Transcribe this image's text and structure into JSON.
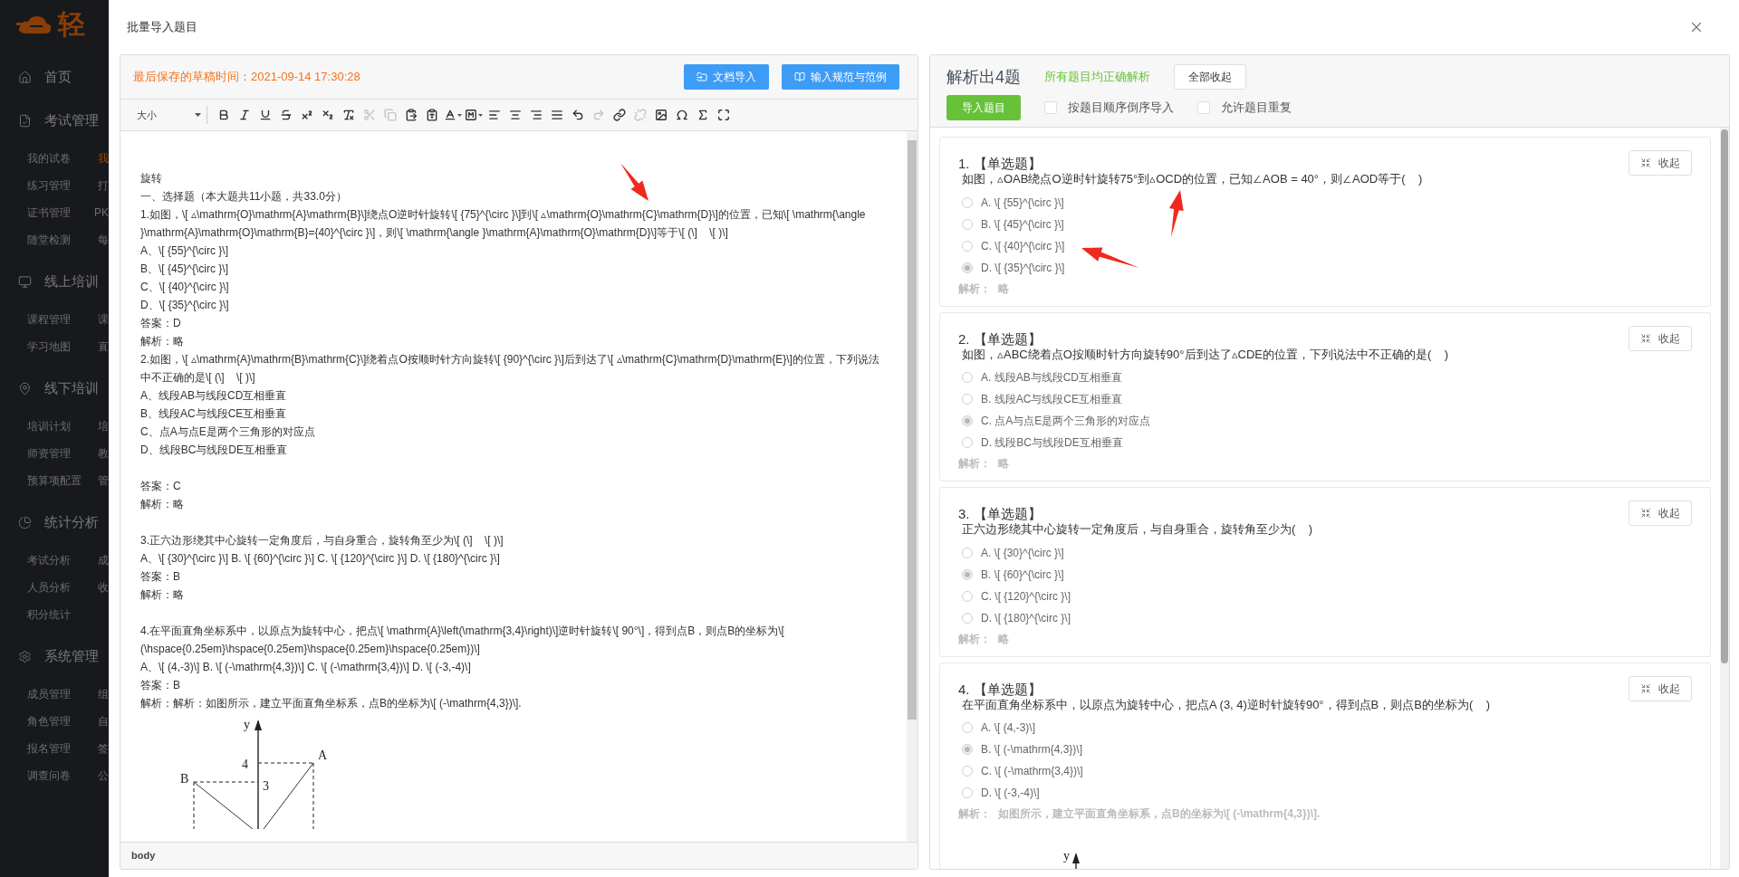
{
  "sidebar": {
    "logo": "轻",
    "sections": [
      {
        "label": "首页"
      },
      {
        "label": "考试管理",
        "rows": [
          [
            {
              "label": "我的试卷",
              "selected": false
            },
            {
              "label": "我",
              "selected": true
            }
          ],
          [
            {
              "label": "练习管理",
              "selected": false
            },
            {
              "label": "打",
              "selected": false
            }
          ],
          [
            {
              "label": "证书管理",
              "selected": false
            },
            {
              "label": "PK",
              "selected": false
            }
          ],
          [
            {
              "label": "随堂检测",
              "selected": false
            },
            {
              "label": "每",
              "selected": false
            }
          ]
        ]
      },
      {
        "label": "线上培训",
        "rows": [
          [
            {
              "label": "课程管理",
              "selected": false
            },
            {
              "label": "课",
              "selected": false
            }
          ],
          [
            {
              "label": "学习地图",
              "selected": false
            },
            {
              "label": "直",
              "selected": false
            }
          ]
        ]
      },
      {
        "label": "线下培训",
        "rows": [
          [
            {
              "label": "培训计划",
              "selected": false
            },
            {
              "label": "培",
              "selected": false
            }
          ],
          [
            {
              "label": "师资管理",
              "selected": false
            },
            {
              "label": "教",
              "selected": false
            }
          ],
          [
            {
              "label": "预算项配置",
              "selected": false
            },
            {
              "label": "管",
              "selected": false
            }
          ]
        ]
      },
      {
        "label": "统计分析",
        "rows": [
          [
            {
              "label": "考试分析",
              "selected": false
            },
            {
              "label": "成",
              "selected": false
            }
          ],
          [
            {
              "label": "人员分析",
              "selected": false
            },
            {
              "label": "收",
              "selected": false
            }
          ],
          [
            {
              "label": "积分统计",
              "selected": false
            }
          ]
        ]
      },
      {
        "label": "系统管理",
        "rows": [
          [
            {
              "label": "成员管理",
              "selected": false
            },
            {
              "label": "组",
              "selected": false
            }
          ],
          [
            {
              "label": "角色管理",
              "selected": false
            },
            {
              "label": "自",
              "selected": false
            }
          ],
          [
            {
              "label": "报名管理",
              "selected": false
            },
            {
              "label": "签",
              "selected": false
            }
          ],
          [
            {
              "label": "调查问卷",
              "selected": false
            },
            {
              "label": "公",
              "selected": false
            }
          ]
        ]
      }
    ]
  },
  "dialog": {
    "title": "批量导入题目"
  },
  "editor": {
    "saved_label": "最后保存的草稿时间：2021-09-14 17:30:28",
    "buttons": [
      "文档导入",
      "输入规范与范例"
    ],
    "toolbar": {
      "size_select": "大小",
      "tools": [
        {
          "disabled": false
        },
        {
          "disabled": false
        },
        {
          "disabled": false
        },
        {
          "disabled": false
        },
        {
          "disabled": false
        },
        {
          "disabled": false
        },
        {
          "disabled": false
        },
        {
          "disabled": true
        },
        {
          "disabled": true
        },
        {
          "disabled": false
        },
        {
          "disabled": false
        },
        {
          "disabled": false
        },
        {
          "disabled": false
        },
        {
          "disabled": false
        },
        {
          "disabled": false
        },
        {
          "disabled": false
        },
        {
          "disabled": false
        },
        {
          "disabled": false
        },
        {
          "disabled": true
        },
        {
          "disabled": false
        },
        {
          "disabled": true
        },
        {
          "disabled": false
        },
        {
          "disabled": false
        },
        {
          "disabled": false
        },
        {
          "disabled": false
        }
      ]
    },
    "groups": [
      [
        "旋转",
        "一、选择题（本大题共11小题，共33.0分）",
        "1.如图，\\[ ▵\\mathrm{O}\\mathrm{A}\\mathrm{B}\\]绕点O逆时针旋转\\[ {75}^{\\circ }\\]到\\[ ▵\\mathrm{O}\\mathrm{C}\\mathrm{D}\\]的位置，已知\\[ \\mathrm{\\angle }\\mathrm{A}\\mathrm{O}\\mathrm{B}={40}^{\\circ }\\]，则\\[ \\mathrm{\\angle }\\mathrm{A}\\mathrm{O}\\mathrm{D}\\]等于\\[ (\\]    \\[ )\\]",
        "A、\\[ {55}^{\\circ }\\]",
        "B、\\[ {45}^{\\circ }\\]",
        "C、\\[ {40}^{\\circ }\\]",
        "D、\\[ {35}^{\\circ }\\]",
        "答案：D",
        "解析：略",
        "2.如图，\\[ ▵\\mathrm{A}\\mathrm{B}\\mathrm{C}\\]绕着点O按顺时针方向旋转\\[ {90}^{\\circ }\\]后到达了\\[ ▵\\mathrm{C}\\mathrm{D}\\mathrm{E}\\]的位置，下列说法中不正确的是\\[ (\\]    \\[ )\\]",
        "A、线段AB与线段CD互相垂直",
        "B、线段AC与线段CE互相垂直",
        "C、点A与点E是两个三角形的对应点",
        "D、线段BC与线段DE互相垂直"
      ],
      [
        "答案：C",
        "解析：略"
      ],
      [
        "3.正六边形绕其中心旋转一定角度后，与自身重合，旋转角至少为\\[ (\\]    \\[ )\\]",
        "A、\\[ {30}^{\\circ }\\] B. \\[ {60}^{\\circ }\\] C. \\[ {120}^{\\circ }\\] D. \\[ {180}^{\\circ }\\]",
        "答案：B",
        "解析：略"
      ],
      [
        "4.在平面直角坐标系中，以原点为旋转中心，把点\\[ \\mathrm{A}\\left(\\mathrm{3,4}\\right)\\]逆时针旋转\\[ 90°\\]，得到点B，则点B的坐标为\\[ (\\hspace{0.25em}\\hspace{0.25em}\\hspace{0.25em}\\hspace{0.25em})\\]",
        "A、\\[ (4,-3)\\] B. \\[ (-\\mathrm{4,3})\\] C. \\[ (-\\mathrm{3,4})\\] D. \\[ (-3,-4)\\]",
        "答案：B",
        "解析：解析：如图所示，建立平面直角坐标系，点B的坐标为\\[ (-\\mathrm{4,3})\\]."
      ]
    ],
    "figure_labels": [
      "y",
      "4",
      "3",
      "A",
      "B"
    ],
    "status": "body"
  },
  "results": {
    "title": "解析出4题",
    "status_text": "所有题目均正确解析",
    "collapse_all": "全部收起",
    "import_button": "导入题目",
    "options": [
      {
        "label": "按题目顺序倒序导入",
        "checked": false
      },
      {
        "label": "允许题目重复",
        "checked": false
      }
    ],
    "questions": [
      {
        "heading": "1. 【单选题】",
        "collapse": "收起",
        "stem": "如图，▵OAB绕点O逆时针旋转75°到▵OCD的位置，已知∠AOB = 40°，则∠AOD等于(    )",
        "choices": [
          {
            "label": "A. \\[ {55}^{\\circ }\\]",
            "selected": false
          },
          {
            "label": "B. \\[ {45}^{\\circ }\\]",
            "selected": false
          },
          {
            "label": "C. \\[ {40}^{\\circ }\\]",
            "selected": false
          },
          {
            "label": "D. \\[ {35}^{\\circ }\\]",
            "selected": true
          }
        ],
        "analysis_label": "解析：",
        "analysis": "略"
      },
      {
        "heading": "2. 【单选题】",
        "collapse": "收起",
        "stem": "如图，▵ABC绕着点O按顺时针方向旋转90°后到达了▵CDE的位置，下列说法中不正确的是(    )",
        "choices": [
          {
            "label": "A. 线段AB与线段CD互相垂直",
            "selected": false
          },
          {
            "label": "B. 线段AC与线段CE互相垂直",
            "selected": false
          },
          {
            "label": "C. 点A与点E是两个三角形的对应点",
            "selected": true
          },
          {
            "label": "D. 线段BC与线段DE互相垂直",
            "selected": false
          }
        ],
        "analysis_label": "解析：",
        "analysis": "略"
      },
      {
        "heading": "3. 【单选题】",
        "collapse": "收起",
        "stem": "正六边形绕其中心旋转一定角度后，与自身重合，旋转角至少为(    )",
        "choices": [
          {
            "label": "A. \\[ {30}^{\\circ }\\]",
            "selected": false
          },
          {
            "label": "B. \\[ {60}^{\\circ }\\]",
            "selected": true
          },
          {
            "label": "C. \\[ {120}^{\\circ }\\]",
            "selected": false
          },
          {
            "label": "D. \\[ {180}^{\\circ }\\]",
            "selected": false
          }
        ],
        "analysis_label": "解析：",
        "analysis": "略"
      },
      {
        "heading": "4. 【单选题】",
        "collapse": "收起",
        "stem": "在平面直角坐标系中，以原点为旋转中心，把点A (3, 4)逆时针旋转90°，得到点B，则点B的坐标为(    )",
        "choices": [
          {
            "label": "A. \\[ (4,-3)\\]",
            "selected": false
          },
          {
            "label": "B. \\[ (-\\mathrm{4,3})\\]",
            "selected": true
          },
          {
            "label": "C. \\[ (-\\mathrm{3,4})\\]",
            "selected": false
          },
          {
            "label": "D. \\[ (-3,-4)\\]",
            "selected": false
          }
        ],
        "analysis_label": "解析：",
        "analysis": "如图所示，建立平面直角坐标系，点B的坐标为\\[ (-\\mathrm{4,3})\\].",
        "figure_labels": [
          "y"
        ]
      }
    ]
  }
}
